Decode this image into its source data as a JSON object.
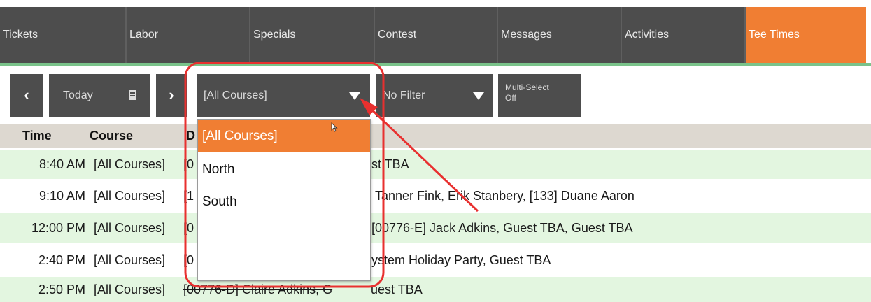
{
  "tabs": [
    {
      "label": "Tickets",
      "active": false
    },
    {
      "label": "Labor",
      "active": false
    },
    {
      "label": "Specials",
      "active": false
    },
    {
      "label": "Contest",
      "active": false
    },
    {
      "label": "Messages",
      "active": false
    },
    {
      "label": "Activities",
      "active": false
    },
    {
      "label": "Tee Times",
      "active": true
    }
  ],
  "toolbar": {
    "prev_icon": "chevron-left-icon",
    "today_label": "Today",
    "calendar_icon": "calendar-icon",
    "next_icon": "chevron-right-icon",
    "course_select_value": "[All Courses]",
    "filter_select_value": "No Filter",
    "multi_select_line1": "Multi-Select",
    "multi_select_line2": "Off"
  },
  "grid": {
    "columns": {
      "time": "Time",
      "course": "Course",
      "desc": "D"
    },
    "rows": [
      {
        "time": "8:40 AM",
        "course": "[All Courses]",
        "desc_left": "[0",
        "desc_right": "st TBA"
      },
      {
        "time": "9:10 AM",
        "course": "[All Courses]",
        "desc_left": "[1",
        "desc_right": "Tanner Fink, Erik Stanbery, [133] Duane Aaron"
      },
      {
        "time": "12:00 PM",
        "course": "[All Courses]",
        "desc_left": "[0",
        "desc_right": "[00776-E] Jack Adkins, Guest TBA, Guest TBA"
      },
      {
        "time": "2:40 PM",
        "course": "[All Courses]",
        "desc_left": "[0",
        "desc_right": "ystem Holiday Party, Guest TBA"
      },
      {
        "time": "2:50 PM",
        "course": "[All Courses]",
        "desc_left": "[00776-D] Claire Adkins, G",
        "desc_right": "uest TBA"
      }
    ]
  },
  "dropdown": {
    "options": [
      {
        "label": "[All Courses]",
        "selected": true
      },
      {
        "label": "North",
        "selected": false
      },
      {
        "label": "South",
        "selected": false
      }
    ]
  },
  "colors": {
    "tab_bg": "#4d4d4d",
    "accent": "#f07e33",
    "tab_underline": "#7ac38a",
    "row_highlight": "#e3f6e0",
    "header_bg": "#ddd8d0",
    "annotation": "#e8302f"
  }
}
